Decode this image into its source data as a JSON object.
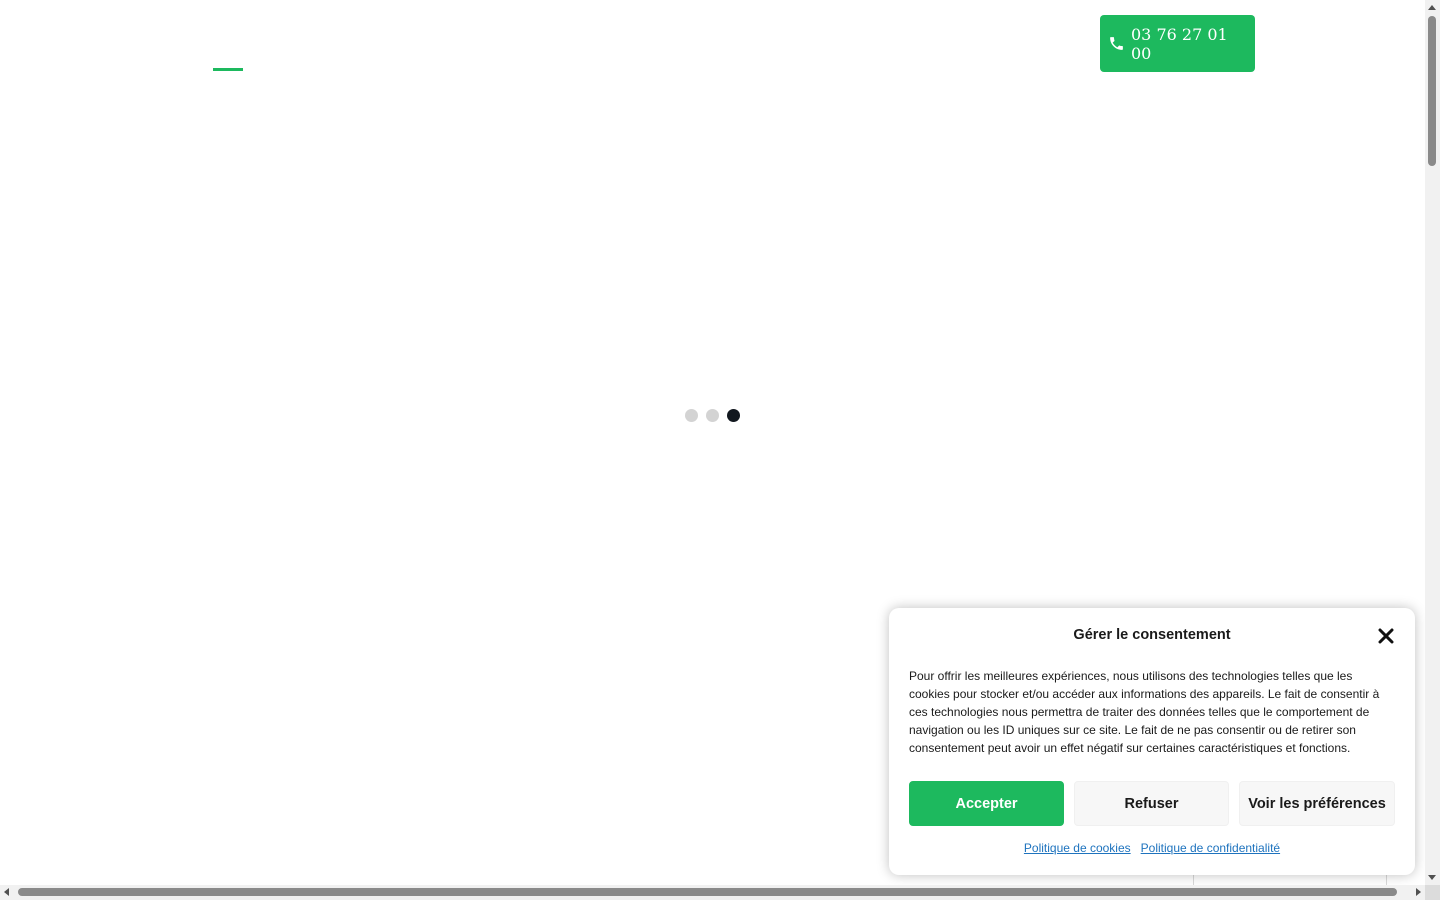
{
  "header": {
    "phone_number": "03 76 27 01 00"
  },
  "loader": {
    "dot_count": 3,
    "active_dot_index": 2
  },
  "consent": {
    "title": "Gérer le consentement",
    "message": "Pour offrir les meilleures expériences, nous utilisons des technologies telles que les cookies pour stocker et/ou accéder aux informations des appareils. Le fait de consentir à ces technologies nous permettra de traiter des données telles que le comportement de navigation ou les ID uniques sur ce site. Le fait de ne pas consentir ou de retirer son consentement peut avoir un effet négatif sur certaines caractéristiques et fonctions.",
    "accept_label": "Accepter",
    "deny_label": "Refuser",
    "preferences_label": "Voir les préférences",
    "cookie_policy_label": "Politique de cookies",
    "privacy_policy_label": "Politique de confidentialité"
  },
  "icons": {
    "phone": "phone-icon",
    "close": "close-icon"
  },
  "colors": {
    "accent": "#1db95e",
    "link": "#1e73be",
    "loader_inactive": "#d3d3d3",
    "loader_active": "#12181f"
  }
}
